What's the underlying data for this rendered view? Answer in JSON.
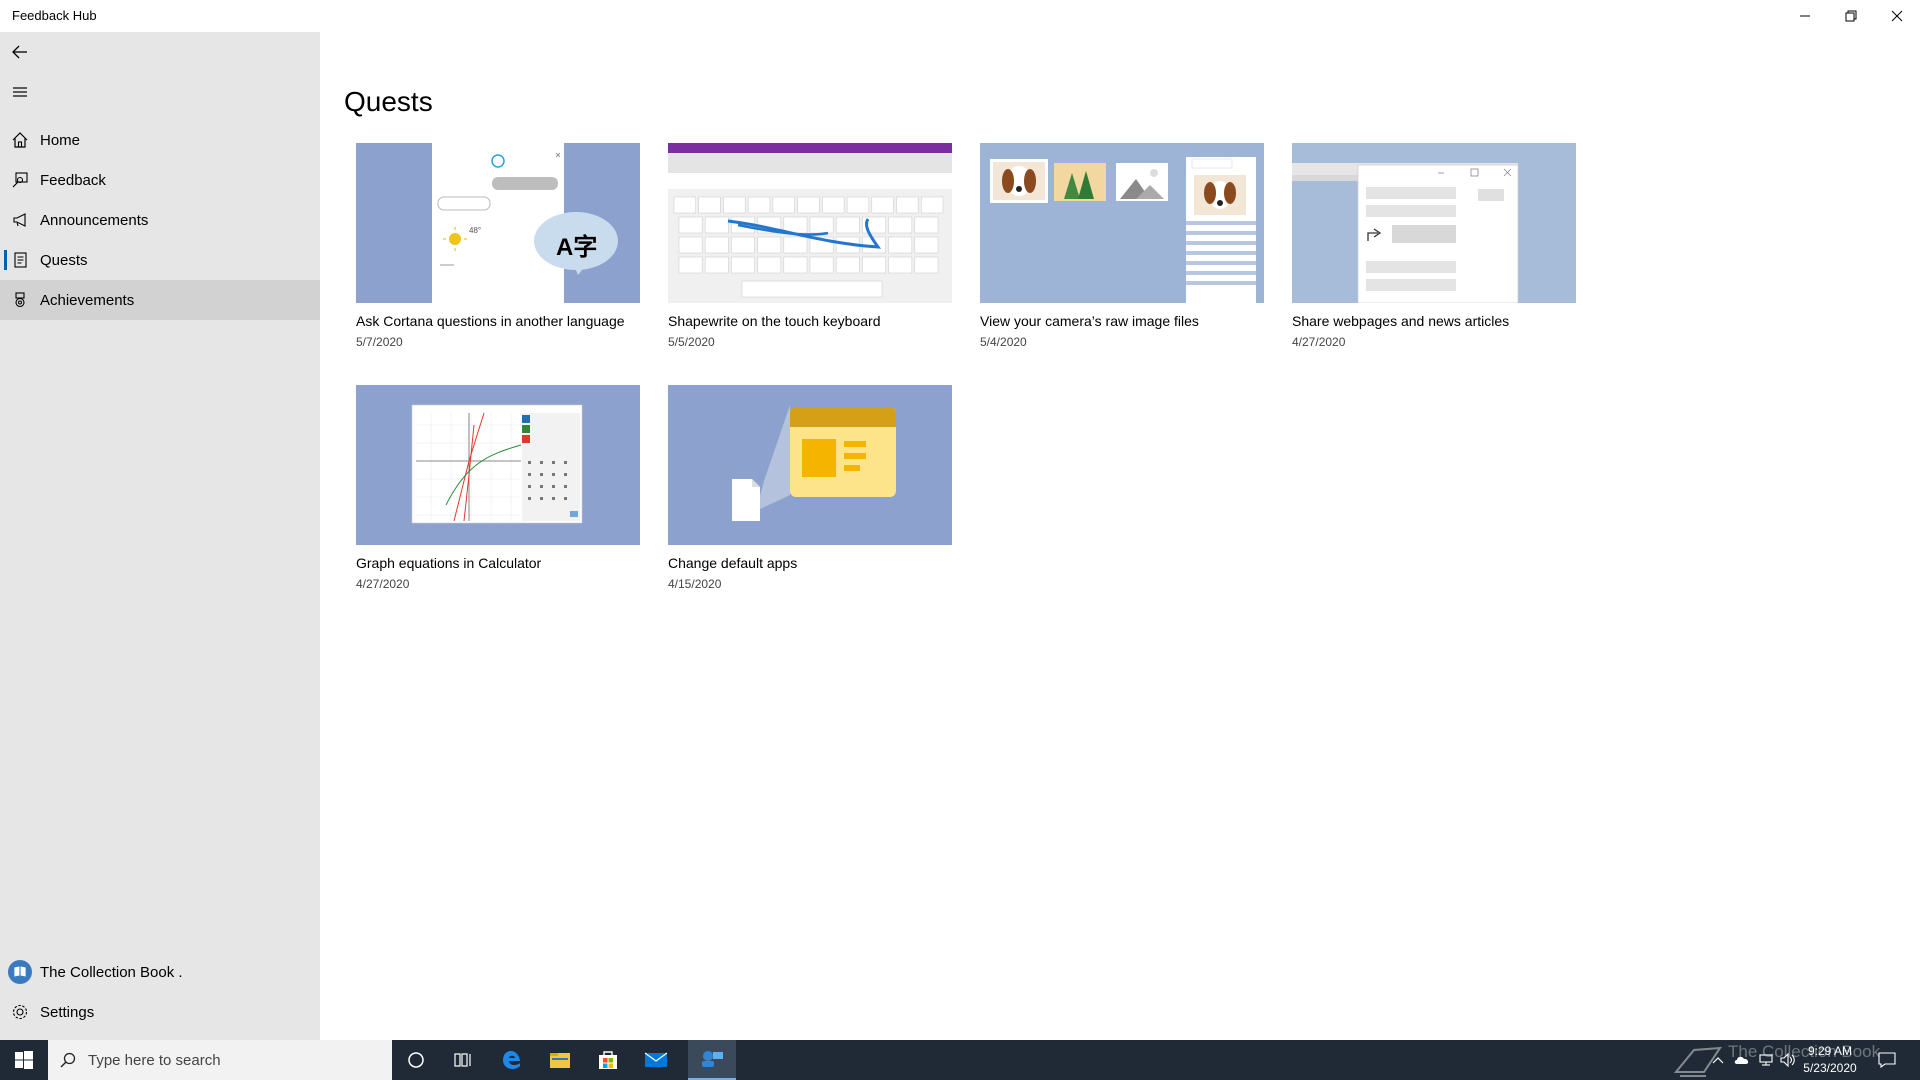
{
  "window": {
    "title": "Feedback Hub"
  },
  "sidebar": {
    "items": [
      {
        "label": "Home"
      },
      {
        "label": "Feedback"
      },
      {
        "label": "Announcements"
      },
      {
        "label": "Quests"
      },
      {
        "label": "Achievements"
      }
    ],
    "account": {
      "label": "The Collection Book ."
    },
    "settings": {
      "label": "Settings"
    }
  },
  "main": {
    "title": "Quests",
    "quests": [
      {
        "title": "Ask Cortana questions in another language",
        "date": "5/7/2020"
      },
      {
        "title": "Shapewrite on the touch keyboard",
        "date": "5/5/2020"
      },
      {
        "title": "View your camera’s raw image files",
        "date": "5/4/2020"
      },
      {
        "title": "Share webpages and news articles",
        "date": "4/27/2020"
      },
      {
        "title": "Graph equations in Calculator",
        "date": "4/27/2020"
      },
      {
        "title": "Change default apps",
        "date": "4/15/2020"
      }
    ]
  },
  "thumbnails": {
    "cortana_temp": "48°",
    "cortana_glyph": "A字"
  },
  "taskbar": {
    "search_placeholder": "Type here to search",
    "time": "9:29 AM",
    "date": "5/23/2020",
    "watermark": "The Collection Book"
  },
  "colors": {
    "accent": "#0063b1",
    "thumb_bg": "#8da1ce",
    "sidebar_bg": "#e6e6e6",
    "taskbar_bg": "#1f2a36"
  }
}
